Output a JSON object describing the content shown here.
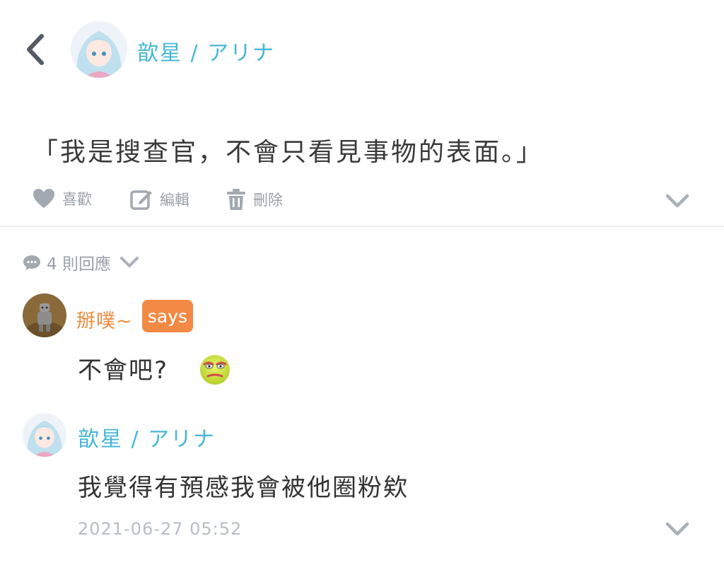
{
  "header": {
    "author_name": "歆星 / アリナ"
  },
  "post": {
    "text": "「我是搜查官，不會只看見事物的表面。」"
  },
  "actions": {
    "like_label": "喜歡",
    "edit_label": "編輯",
    "delete_label": "刪除"
  },
  "replies": {
    "count_label": "4 則回應"
  },
  "comments": [
    {
      "author": "掰噗~",
      "badge": "says",
      "text": "不會吧?"
    },
    {
      "author": "歆星 / アリナ",
      "text": "我覺得有預感我會被他圈粉欸",
      "timestamp": "2021-06-27 05:52"
    }
  ],
  "colors": {
    "author_blue": "#47b7d6",
    "commenter_orange": "#f08a3c",
    "badge_orange": "#f28a45",
    "muted_gray": "#9aa0a8"
  }
}
